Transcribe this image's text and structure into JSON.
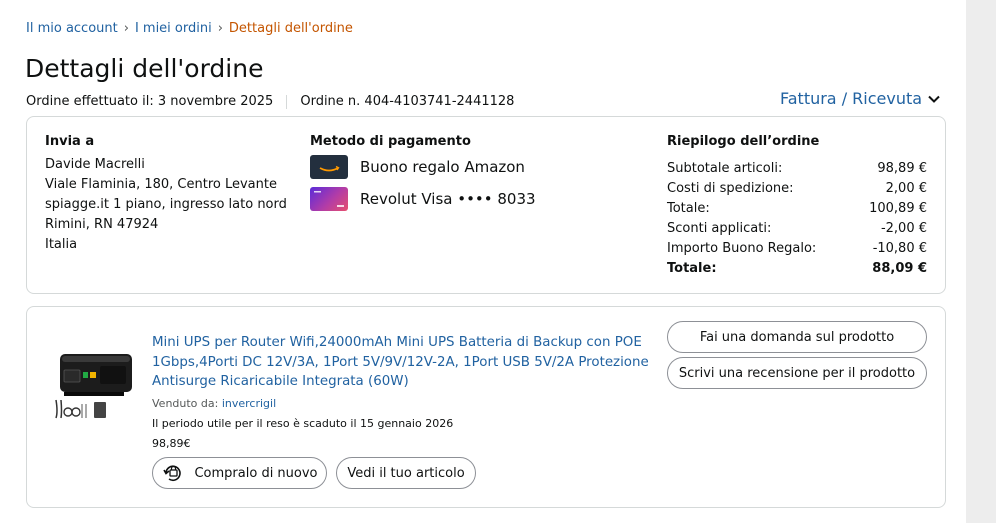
{
  "breadcrumb": {
    "items": [
      "Il mio account",
      "I miei ordini"
    ],
    "current": "Dettagli dell'ordine"
  },
  "page_title": "Dettagli dell'ordine",
  "order_meta": {
    "placed": "Ordine effettuato il: 3 novembre 2025",
    "number": "Ordine n. 404-4103741-2441128"
  },
  "invoice_link": "Fattura / Ricevuta",
  "shipping": {
    "heading": "Invia a",
    "lines": [
      "Davide Macrelli",
      "Viale Flaminia, 180, Centro Levante",
      "spiagge.it 1 piano, ingresso lato nord",
      "Rimini, RN 47924",
      "Italia"
    ]
  },
  "payment": {
    "heading": "Metodo di pagamento",
    "methods": [
      {
        "icon": "amazon-gift-card-icon",
        "label": "Buono regalo Amazon"
      },
      {
        "icon": "revolut-visa-card-icon",
        "label": "Revolut Visa •••• 8033"
      }
    ]
  },
  "summary": {
    "heading": "Riepilogo dell’ordine",
    "rows": [
      {
        "label": "Subtotale articoli:",
        "value": "98,89 €"
      },
      {
        "label": "Costi di spedizione:",
        "value": "2,00 €"
      },
      {
        "label": "Totale:",
        "value": "100,89 €"
      },
      {
        "label": "Sconti applicati:",
        "value": "-2,00 €"
      },
      {
        "label": "Importo Buono Regalo:",
        "value": "-10,80 €"
      }
    ],
    "total": {
      "label": "Totale:",
      "value": "88,09 €"
    }
  },
  "product": {
    "title": "Mini UPS per Router Wifi,24000mAh Mini UPS Batteria di Backup con POE 1Gbps,4Porti DC 12V/3A, 1Port 5V/9V/12V-2A, 1Port USB 5V/2A Protezione Antisurge Ricaricabile Integrata (60W)",
    "sold_by_label": "Venduto da:",
    "seller": "invercrigil",
    "return_text": "Il periodo utile per il reso è scaduto il 15 gennaio 2026",
    "price": "98,89€",
    "buy_again": "Compralo di nuovo",
    "view_item": "Vedi il tuo articolo",
    "ask_question": "Fai una domanda sul prodotto",
    "write_review": "Scrivi una recensione per il prodotto"
  },
  "colors": {
    "link": "#2162a1",
    "breadcrumb_current": "#c45500",
    "border": "#d5d9d9"
  }
}
